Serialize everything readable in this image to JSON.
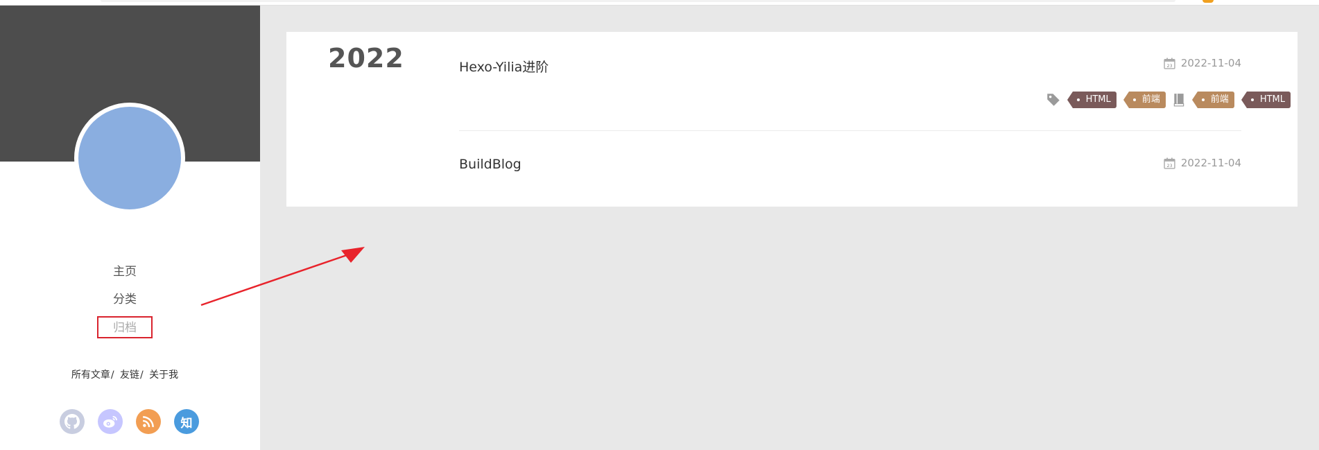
{
  "sidebar": {
    "nav": [
      {
        "label": "主页",
        "active": false
      },
      {
        "label": "分类",
        "active": false
      },
      {
        "label": "归档",
        "active": true
      }
    ],
    "links": [
      "所有文章",
      "友链",
      "关于我"
    ],
    "link_separator": "/",
    "social": [
      {
        "icon": "github-icon",
        "color": "#c8cde0"
      },
      {
        "icon": "weibo-icon",
        "color": "#c6c6ff"
      },
      {
        "icon": "rss-icon",
        "color": "#f29e53"
      },
      {
        "icon": "zhihu-icon",
        "label": "知",
        "color": "#4a9bde"
      }
    ]
  },
  "archive": {
    "year": "2022",
    "posts": [
      {
        "title": "Hexo-Yilia进阶",
        "date": "2022-11-04",
        "tags": [
          "HTML",
          "前端"
        ],
        "categories": [
          "前端",
          "HTML"
        ]
      },
      {
        "title": "BuildBlog",
        "date": "2022-11-04"
      }
    ]
  },
  "annotation": {
    "type": "arrow",
    "color": "#e8232b"
  }
}
